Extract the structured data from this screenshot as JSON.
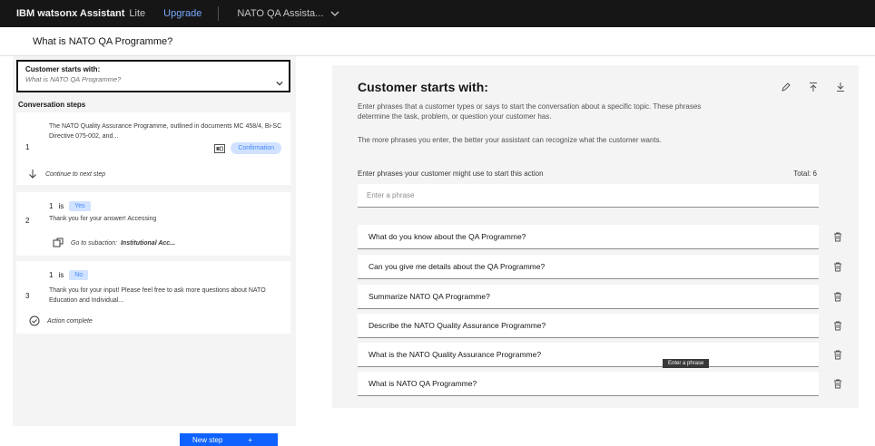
{
  "topbar": {
    "product": "IBM watsonx Assistant",
    "plan": "Lite",
    "upgrade": "Upgrade",
    "assistant_name": "NATO QA Assista..."
  },
  "action": {
    "title": "What is NATO QA Programme?"
  },
  "left": {
    "starter_title": "Customer starts with:",
    "starter_sub": "What is NATO QA Programme?",
    "steps_heading": "Conversation steps",
    "steps": [
      {
        "number": "1",
        "text": "The NATO Quality Assurance Programme, outlined in documents MC 458/4, Bi-SC Directive 075-002, and...",
        "tag": "Confirmation",
        "footer": "Continue to next step"
      },
      {
        "number": "2",
        "cond_num": "1",
        "cond_is": "is",
        "cond_value": "Yes",
        "text": "Thank you for your answer! Accessing",
        "footer_prefix": "Go to subaction:",
        "footer_bold": "Institutional Acc..."
      },
      {
        "number": "3",
        "cond_num": "1",
        "cond_is": "is",
        "cond_value": "No",
        "text": "Thank you for your input! Please feel free to ask more questions about NATO Education and Individual...",
        "footer": "Action complete"
      }
    ],
    "new_step": "New step",
    "new_step_plus": "+"
  },
  "right": {
    "title": "Customer starts with:",
    "desc1": "Enter phrases that a customer types or says to start the conversation about a specific topic. These phrases determine the task, problem, or question your customer has.",
    "desc2": "The more phrases you enter, the better your assistant can recognize what the customer wants.",
    "label": "Enter phrases your customer might use to start this action",
    "total": "Total: 6",
    "input_placeholder": "Enter a phrase",
    "phrases": [
      "What do you know about the QA Programme?",
      "Can you give me details about the QA Programme?",
      "Summarize NATO QA Programme?",
      "Describe the NATO Quality Assurance Programme?",
      "What is the NATO Quality Assurance Programme?",
      "What is NATO QA Programme?"
    ],
    "tooltip": "Enter a phrase"
  },
  "colors": {
    "topbar": "#161616",
    "accent": "#0f62fe",
    "tag_bg": "#d0e2ff",
    "tag_text": "#4589ff",
    "panel": "#f4f4f4"
  }
}
